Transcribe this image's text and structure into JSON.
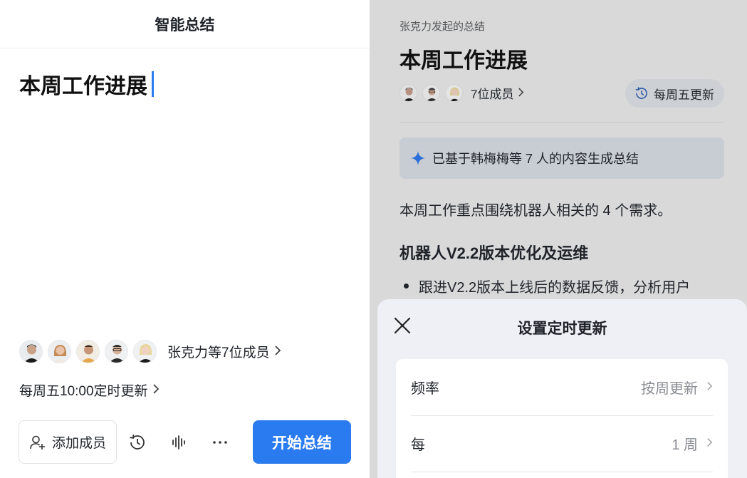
{
  "left": {
    "header_title": "智能总结",
    "doc_title": "本周工作进展",
    "members_label": "张克力等7位成员",
    "schedule_label": "每周五10:00定时更新",
    "add_member_label": "添加成员",
    "start_label": "开始总结"
  },
  "right": {
    "initiator": "张克力发起的总结",
    "title": "本周工作进展",
    "members_label": "7位成员",
    "weekly_label": "每周五更新",
    "ai_banner": "已基于韩梅梅等 7 人的内容生成总结",
    "paragraph": "本周工作重点围绕机器人相关的 4 个需求。",
    "heading": "机器人V2.2版本优化及运维",
    "bullet": "跟进V2.2版本上线后的数据反馈，分析用户"
  },
  "sheet": {
    "title": "设置定时更新",
    "rows": [
      {
        "label": "频率",
        "value": "按周更新"
      },
      {
        "label": "每",
        "value": "1 周"
      }
    ]
  },
  "colors": {
    "accent": "#2a7af0",
    "panel_gray": "#d9d9d9",
    "sheet_bg": "#eef0f5"
  },
  "icons": [
    "add-user-icon",
    "history-icon",
    "voice-wave-icon",
    "more-icon",
    "sparkle-icon",
    "close-icon",
    "chevron-right-icon"
  ]
}
